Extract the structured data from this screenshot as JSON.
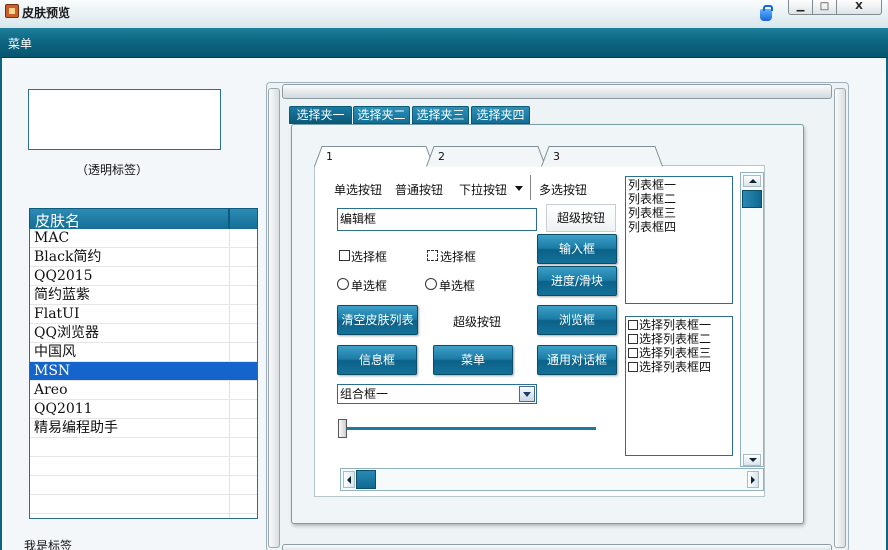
{
  "window": {
    "title": "皮肤预览",
    "min_label": "▁",
    "max_label": "□",
    "close_label": "X"
  },
  "menu": {
    "item": "菜单"
  },
  "left": {
    "transparent_label": "（透明标签）",
    "list_header": "皮肤名",
    "skins": [
      "MAC",
      "Black简约",
      "QQ2015",
      "简约蓝紫",
      "FlatUI",
      "QQ浏览器",
      "中国风",
      "MSN",
      "Areo",
      "QQ2011",
      "精易编程助手"
    ],
    "selected_skin": "MSN",
    "bottom_label": "我是标签"
  },
  "tabs": {
    "outer": [
      "选择夹一",
      "选择夹二",
      "选择夹三",
      "选择夹四"
    ],
    "inner": [
      "1",
      "2",
      "3"
    ]
  },
  "panel": {
    "radio_button_label": "单选按钮",
    "plain_button_label": "普通按钮",
    "dropdown_button_label": "下拉按钮",
    "multi_select_button_label": "多选按钮",
    "super_button_top": "超级按钮",
    "edit_box_value": "编辑框",
    "input_box_button": "输入框",
    "checkbox_1": "选择框",
    "checkbox_2": "选择框",
    "progress_slider_button": "进度/滑块",
    "radio_1": "单选框",
    "radio_2": "单选框",
    "clear_skin_list_button": "清空皮肤列表",
    "super_button_middle": "超级按钮",
    "browse_button": "浏览框",
    "message_box_button": "信息框",
    "menu_button": "菜单",
    "common_dialog_button": "通用对话框",
    "combo_value": "组合框一",
    "list_box_items": [
      "列表框一",
      "列表框二",
      "列表框三",
      "列表框四"
    ],
    "check_list_items": [
      "选择列表框一",
      "选择列表框二",
      "选择列表框三",
      "选择列表框四"
    ]
  },
  "colors": {
    "accent": "#0c6480",
    "selection": "#1464cc",
    "button": "#1a7aa4"
  }
}
